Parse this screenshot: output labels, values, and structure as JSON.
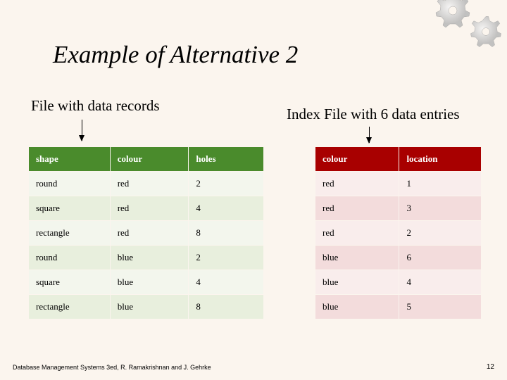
{
  "title": "Example of Alternative 2",
  "labels": {
    "left": "File with data records",
    "right": "Index File with 6 data entries"
  },
  "left_table": {
    "headers": [
      "shape",
      "colour",
      "holes"
    ],
    "rows": [
      [
        "round",
        "red",
        "2"
      ],
      [
        "square",
        "red",
        "4"
      ],
      [
        "rectangle",
        "red",
        "8"
      ],
      [
        "round",
        "blue",
        "2"
      ],
      [
        "square",
        "blue",
        "4"
      ],
      [
        "rectangle",
        "blue",
        "8"
      ]
    ]
  },
  "right_table": {
    "headers": [
      "colour",
      "location"
    ],
    "rows": [
      [
        "red",
        "1"
      ],
      [
        "red",
        "3"
      ],
      [
        "red",
        "2"
      ],
      [
        "blue",
        "6"
      ],
      [
        "blue",
        "4"
      ],
      [
        "blue",
        "5"
      ]
    ]
  },
  "footer": "Database Management Systems 3ed, R. Ramakrishnan and J. Gehrke",
  "pagenum": "12"
}
